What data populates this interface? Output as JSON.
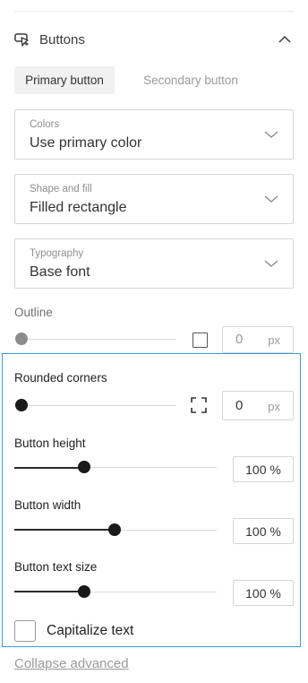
{
  "section": {
    "title": "Buttons",
    "icon": "cursor-click-icon",
    "toggle_icon": "chevron-up-icon"
  },
  "tabs": [
    {
      "label": "Primary button",
      "active": true
    },
    {
      "label": "Secondary button",
      "active": false
    }
  ],
  "selects": [
    {
      "caption": "Colors",
      "value": "Use primary color"
    },
    {
      "caption": "Shape and fill",
      "value": "Filled rectangle"
    },
    {
      "caption": "Typography",
      "value": "Base font"
    }
  ],
  "outline": {
    "label": "Outline",
    "value": "0",
    "unit": "px",
    "slider_fraction": 0,
    "checked": false
  },
  "rounded_corners": {
    "label": "Rounded corners",
    "value": "0",
    "unit": "px",
    "slider_fraction": 0,
    "icon": "expand-corners-icon"
  },
  "button_height": {
    "label": "Button height",
    "value": "100 %",
    "slider_fraction": 0.34
  },
  "button_width": {
    "label": "Button width",
    "value": "100 %",
    "slider_fraction": 0.5
  },
  "button_text_size": {
    "label": "Button text size",
    "value": "100 %",
    "slider_fraction": 0.34
  },
  "capitalize": {
    "label": "Capitalize text",
    "checked": false
  },
  "collapse_link": "Collapse advanced",
  "colors": {
    "selection_outline": "#3d9bd6",
    "knob": "#1a1a1a"
  }
}
